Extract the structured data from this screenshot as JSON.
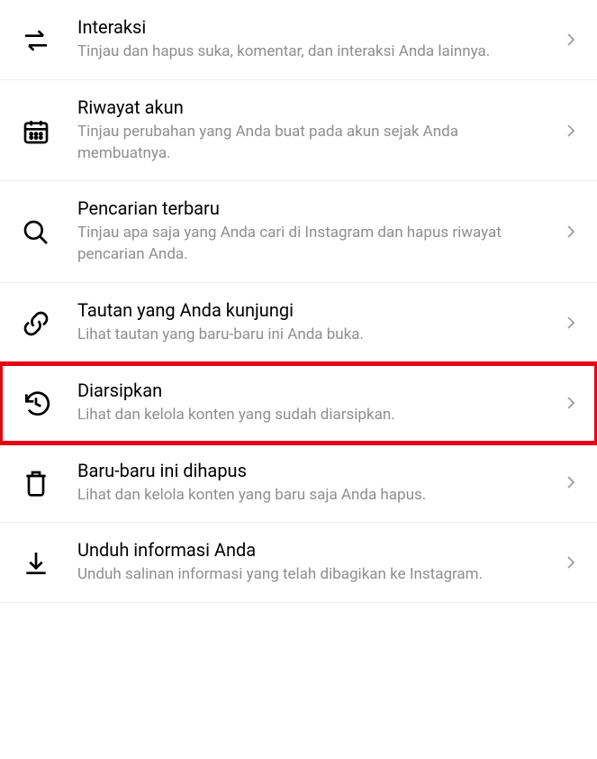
{
  "items": [
    {
      "title": "Interaksi",
      "subtitle": "Tinjau dan hapus suka, komentar, dan interaksi Anda lainnya."
    },
    {
      "title": "Riwayat akun",
      "subtitle": "Tinjau perubahan yang Anda buat pada akun sejak Anda membuatnya."
    },
    {
      "title": "Pencarian terbaru",
      "subtitle": "Tinjau apa saja yang Anda cari di Instagram dan hapus riwayat pencarian Anda."
    },
    {
      "title": "Tautan yang Anda kunjungi",
      "subtitle": "Lihat tautan yang baru-baru ini Anda buka."
    },
    {
      "title": "Diarsipkan",
      "subtitle": "Lihat dan kelola konten yang sudah diarsipkan."
    },
    {
      "title": "Baru-baru ini dihapus",
      "subtitle": "Lihat dan kelola konten yang baru saja Anda hapus."
    },
    {
      "title": "Unduh informasi Anda",
      "subtitle": "Unduh salinan informasi yang telah dibagikan ke Instagram."
    }
  ]
}
